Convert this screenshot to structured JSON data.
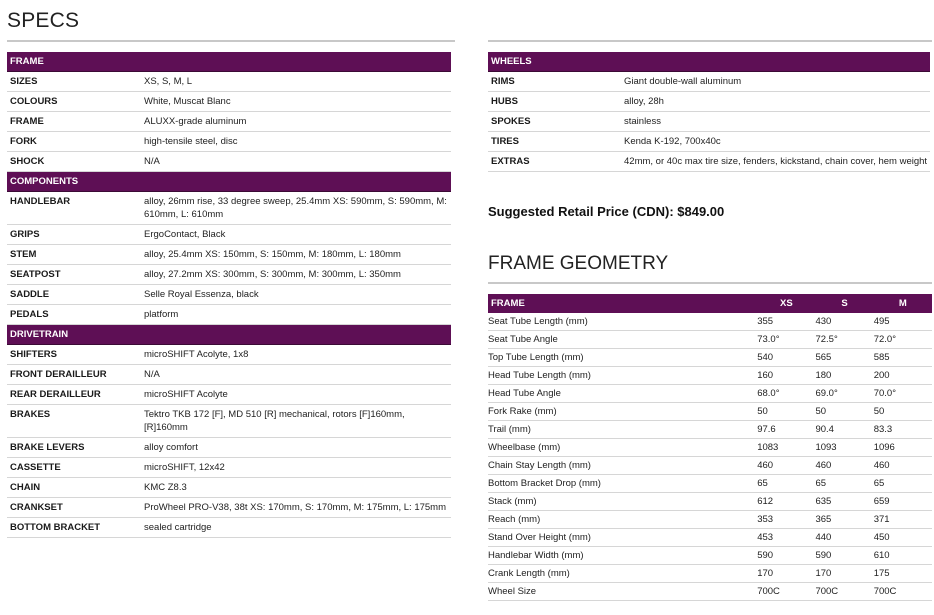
{
  "page_title": "SPECS",
  "left_sections": [
    {
      "heading": "FRAME",
      "rows": [
        {
          "label": "SIZES",
          "value": "XS, S, M, L"
        },
        {
          "label": "COLOURS",
          "value": "White, Muscat Blanc"
        },
        {
          "label": "FRAME",
          "value": "ALUXX-grade aluminum"
        },
        {
          "label": "FORK",
          "value": "high-tensile steel, disc"
        },
        {
          "label": "SHOCK",
          "value": "N/A"
        }
      ]
    },
    {
      "heading": "COMPONENTS",
      "rows": [
        {
          "label": "HANDLEBAR",
          "value": "alloy, 26mm rise, 33 degree sweep, 25.4mm XS: 590mm, S: 590mm, M: 610mm, L: 610mm"
        },
        {
          "label": "GRIPS",
          "value": "ErgoContact, Black"
        },
        {
          "label": "STEM",
          "value": "alloy, 25.4mm XS: 150mm, S: 150mm, M: 180mm, L: 180mm"
        },
        {
          "label": "SEATPOST",
          "value": "alloy, 27.2mm XS: 300mm, S: 300mm, M: 300mm, L: 350mm"
        },
        {
          "label": "SADDLE",
          "value": "Selle Royal Essenza, black"
        },
        {
          "label": "PEDALS",
          "value": "platform"
        }
      ]
    },
    {
      "heading": "DRIVETRAIN",
      "rows": [
        {
          "label": "SHIFTERS",
          "value": "microSHIFT Acolyte, 1x8"
        },
        {
          "label": "FRONT DERAILLEUR",
          "value": "N/A"
        },
        {
          "label": "REAR DERAILLEUR",
          "value": "microSHIFT Acolyte"
        },
        {
          "label": "BRAKES",
          "value": "Tektro TKB 172 [F], MD 510 [R] mechanical, rotors [F]160mm, [R]160mm"
        },
        {
          "label": "BRAKE LEVERS",
          "value": "alloy comfort"
        },
        {
          "label": "CASSETTE",
          "value": "microSHIFT, 12x42"
        },
        {
          "label": "CHAIN",
          "value": "KMC Z8.3"
        },
        {
          "label": "CRANKSET",
          "value": "ProWheel PRO-V38, 38t XS: 170mm, S: 170mm, M: 175mm, L: 175mm"
        },
        {
          "label": "BOTTOM BRACKET",
          "value": "sealed cartridge"
        }
      ]
    }
  ],
  "right_sections": [
    {
      "heading": "WHEELS",
      "rows": [
        {
          "label": "RIMS",
          "value": "Giant double-wall aluminum"
        },
        {
          "label": "HUBS",
          "value": "alloy, 28h"
        },
        {
          "label": "SPOKES",
          "value": "stainless"
        },
        {
          "label": "TIRES",
          "value": "Kenda K-192, 700x40c"
        },
        {
          "label": "EXTRAS",
          "value": "42mm, or 40c max tire size, fenders, kickstand, chain cover, hem weight"
        }
      ]
    }
  ],
  "price_text": "Suggested Retail Price (CDN): $849.00",
  "geometry": {
    "title": "FRAME GEOMETRY",
    "headers": [
      "FRAME",
      "XS",
      "S",
      "M"
    ],
    "rows": [
      {
        "name": "Seat Tube Length (mm)",
        "values": [
          "355",
          "430",
          "495"
        ]
      },
      {
        "name": "Seat Tube Angle",
        "values": [
          "73.0°",
          "72.5°",
          "72.0°"
        ]
      },
      {
        "name": "Top Tube Length (mm)",
        "values": [
          "540",
          "565",
          "585"
        ]
      },
      {
        "name": "Head Tube Length (mm)",
        "values": [
          "160",
          "180",
          "200"
        ]
      },
      {
        "name": "Head Tube Angle",
        "values": [
          "68.0°",
          "69.0°",
          "70.0°"
        ]
      },
      {
        "name": "Fork Rake (mm)",
        "values": [
          "50",
          "50",
          "50"
        ]
      },
      {
        "name": "Trail (mm)",
        "values": [
          "97.6",
          "90.4",
          "83.3"
        ]
      },
      {
        "name": "Wheelbase (mm)",
        "values": [
          "1083",
          "1093",
          "1096"
        ]
      },
      {
        "name": "Chain Stay Length (mm)",
        "values": [
          "460",
          "460",
          "460"
        ]
      },
      {
        "name": "Bottom Bracket Drop (mm)",
        "values": [
          "65",
          "65",
          "65"
        ]
      },
      {
        "name": "Stack (mm)",
        "values": [
          "612",
          "635",
          "659"
        ]
      },
      {
        "name": "Reach (mm)",
        "values": [
          "353",
          "365",
          "371"
        ]
      },
      {
        "name": "Stand Over Height (mm)",
        "values": [
          "453",
          "440",
          "450"
        ]
      },
      {
        "name": "Handlebar Width (mm)",
        "values": [
          "590",
          "590",
          "610"
        ]
      },
      {
        "name": "Crank Length (mm)",
        "values": [
          "170",
          "170",
          "175"
        ]
      },
      {
        "name": "Wheel Size",
        "values": [
          "700C",
          "700C",
          "700C"
        ]
      }
    ]
  },
  "colors": {
    "header_bg": "#5e0f55",
    "header_text": "#ffffff",
    "rule": "#c8c8c8",
    "row_border": "#d6d6d6"
  }
}
